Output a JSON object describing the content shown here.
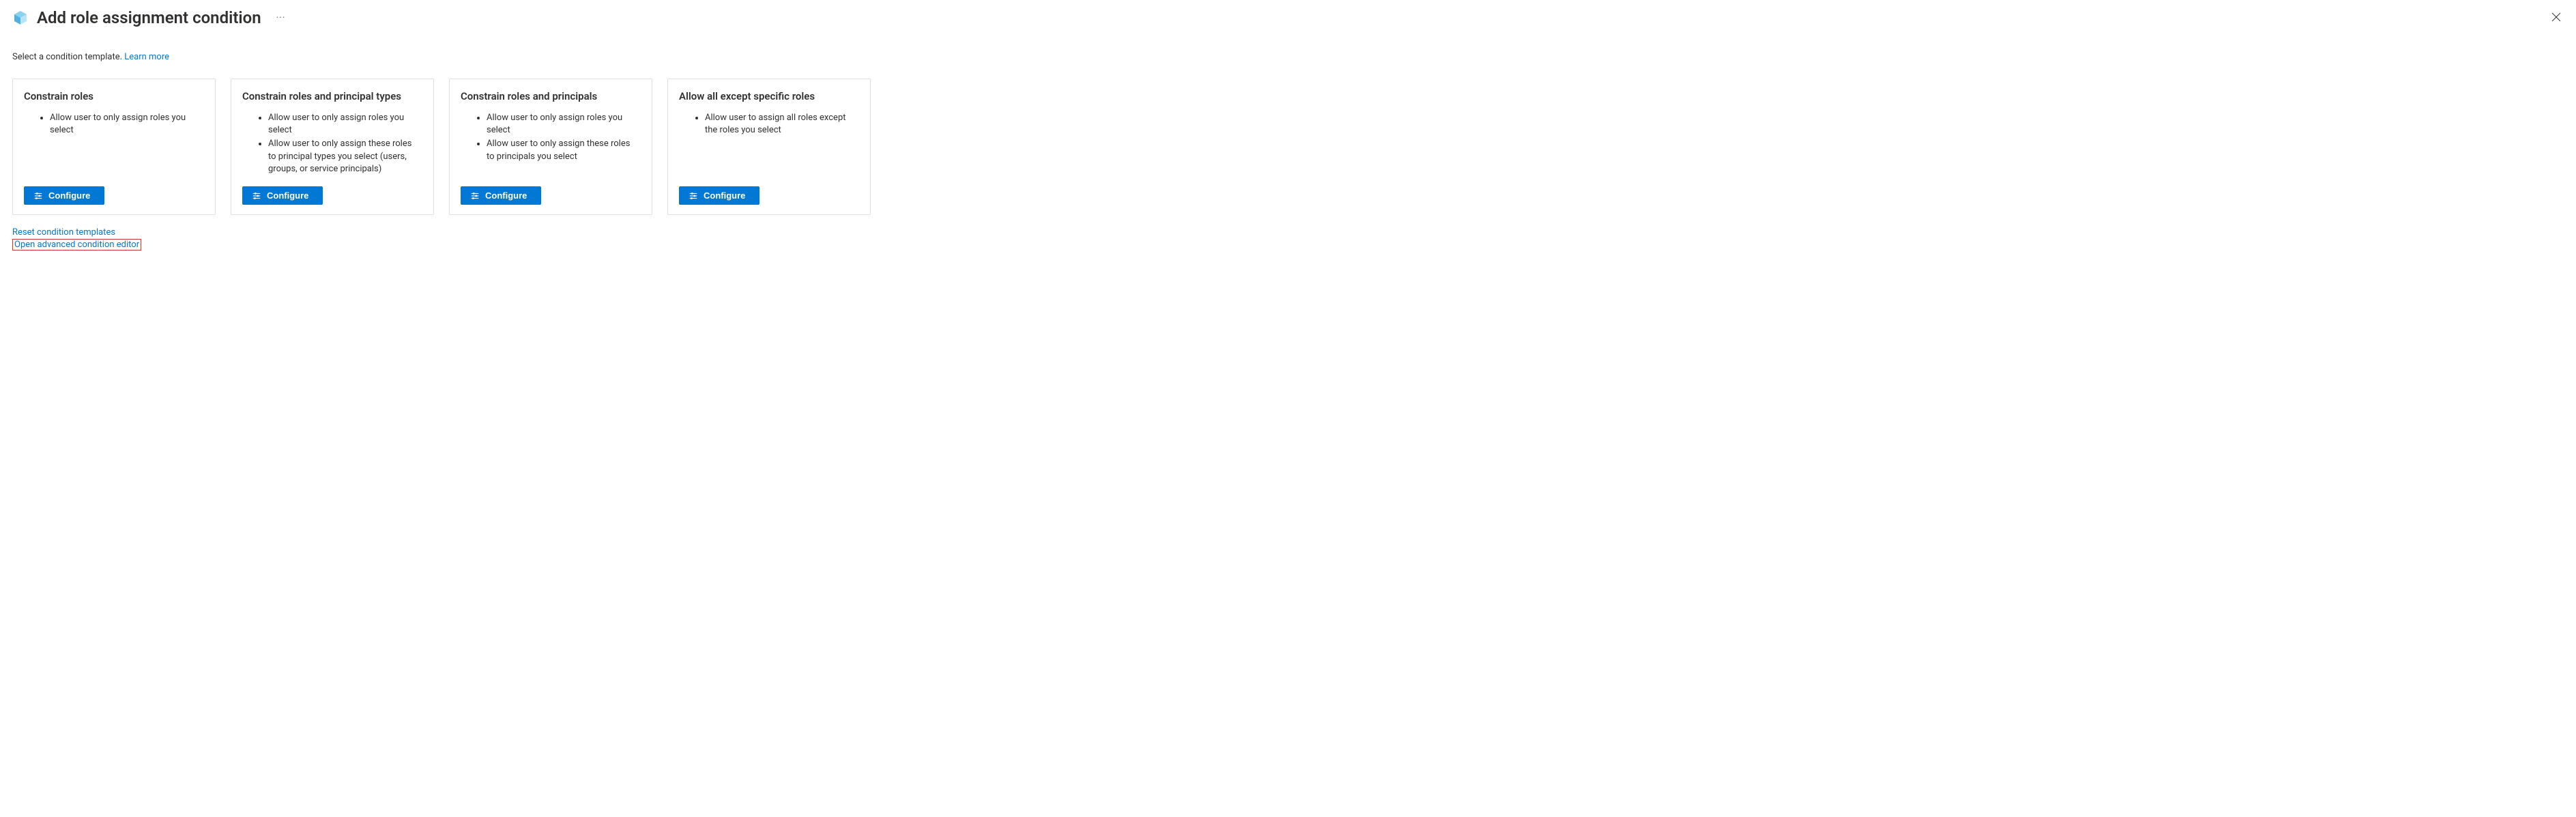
{
  "header": {
    "title": "Add role assignment condition"
  },
  "prompt": {
    "text": "Select a condition template. ",
    "learn_more": "Learn more"
  },
  "cards": [
    {
      "title": "Constrain roles",
      "bullets": [
        "Allow user to only assign roles you select"
      ],
      "button": "Configure"
    },
    {
      "title": "Constrain roles and principal types",
      "bullets": [
        "Allow user to only assign roles you select",
        "Allow user to only assign these roles to principal types you select (users, groups, or service principals)"
      ],
      "button": "Configure"
    },
    {
      "title": "Constrain roles and principals",
      "bullets": [
        "Allow user to only assign roles you select",
        "Allow user to only assign these roles to principals you select"
      ],
      "button": "Configure"
    },
    {
      "title": "Allow all except specific roles",
      "bullets": [
        "Allow user to assign all roles except the roles you select"
      ],
      "button": "Configure"
    }
  ],
  "footer": {
    "reset": "Reset condition templates",
    "advanced": "Open advanced condition editor"
  }
}
